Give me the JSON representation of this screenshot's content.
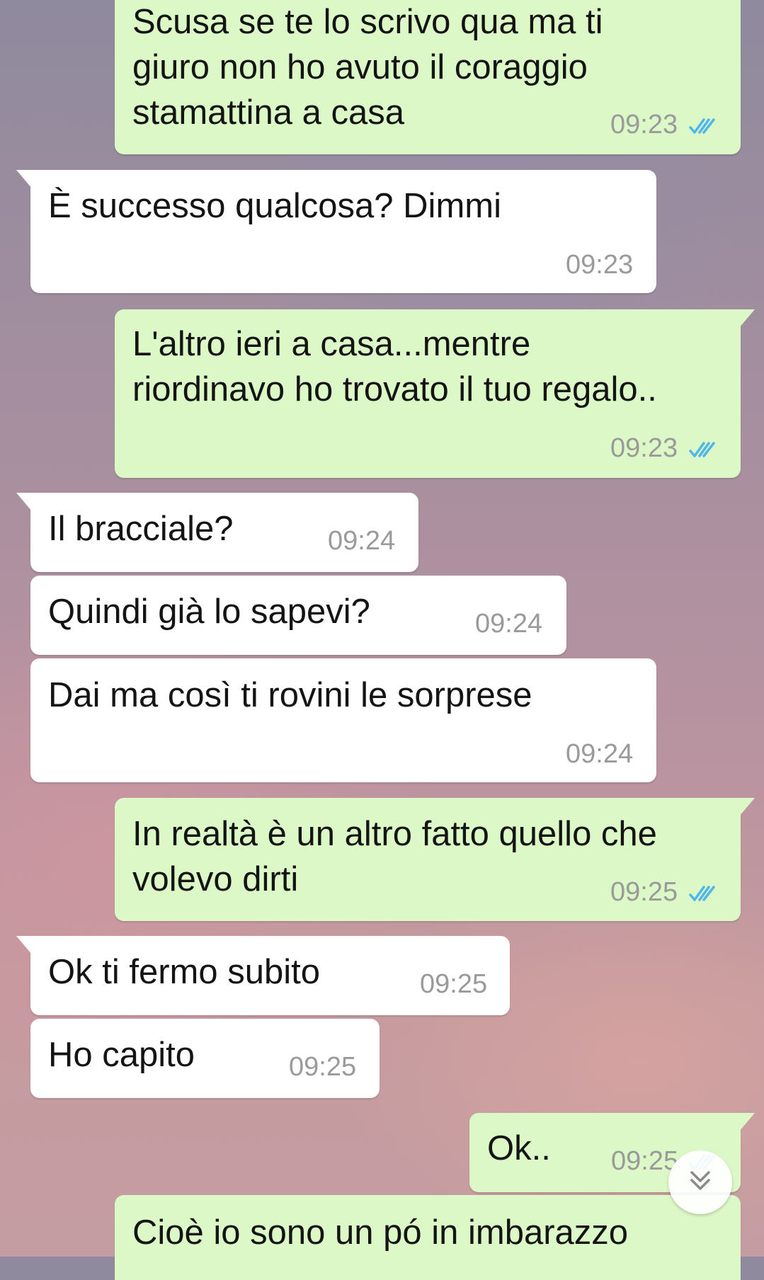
{
  "messages": [
    {
      "direction": "out",
      "text": "Scusa se te lo scrivo qua ma ti\ngiuro non ho avuto il coraggio\nstamattina a casa",
      "time": "09:23",
      "read": true
    },
    {
      "direction": "in",
      "text": "È successo qualcosa? Dimmi",
      "time": "09:23"
    },
    {
      "direction": "out",
      "text": "L'altro ieri a casa...mentre\nriordinavo ho trovato il tuo regalo..",
      "time": "09:23",
      "read": true
    },
    {
      "direction": "in",
      "text": "Il bracciale?",
      "time": "09:24"
    },
    {
      "direction": "in",
      "text": "Quindi già lo sapevi?",
      "time": "09:24"
    },
    {
      "direction": "in",
      "text": "Dai ma così ti rovini le sorprese",
      "time": "09:24"
    },
    {
      "direction": "out",
      "text": "In realtà è un altro fatto quello che\nvolevo dirti",
      "time": "09:25",
      "read": true
    },
    {
      "direction": "in",
      "text": "Ok ti fermo subito",
      "time": "09:25"
    },
    {
      "direction": "in",
      "text": "Ho capito",
      "time": "09:25"
    },
    {
      "direction": "out",
      "text": "Ok..",
      "time": "09:25",
      "read": true
    },
    {
      "direction": "out",
      "text": "Cioè io sono un pó in imbarazzo",
      "time": "",
      "read": false
    }
  ],
  "icons": {
    "read_receipt": "double-check-icon",
    "scroll_down": "double-chevron-down-icon"
  },
  "colors": {
    "outgoing_bubble": "#dcf8c6",
    "incoming_bubble": "#ffffff",
    "read_tick": "#4fb6ec",
    "timestamp": "#9a9a9a"
  }
}
